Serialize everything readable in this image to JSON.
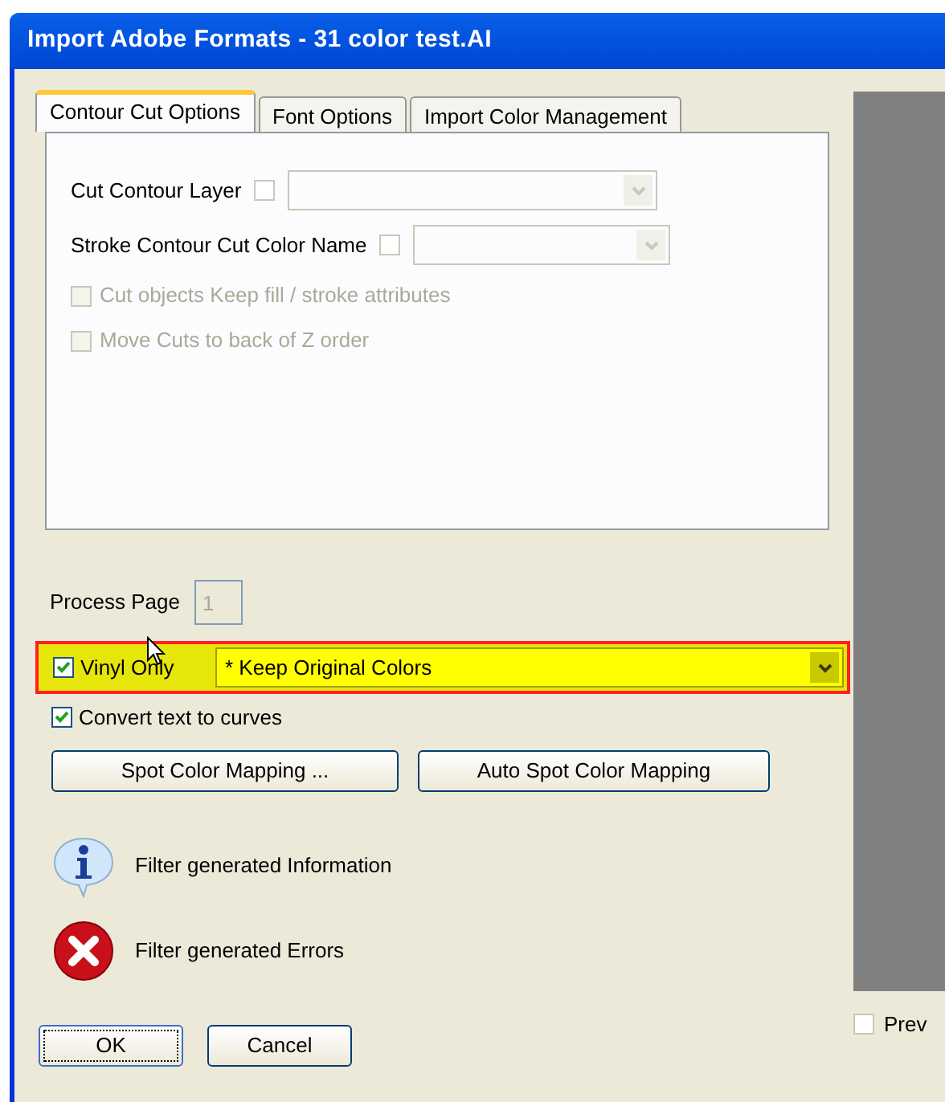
{
  "window": {
    "title": "Import Adobe Formats - 31 color test.AI"
  },
  "tabs": [
    {
      "label": "Contour Cut Options",
      "selected": true
    },
    {
      "label": "Font Options",
      "selected": false
    },
    {
      "label": "Import Color Management",
      "selected": false
    }
  ],
  "contour_options": [
    {
      "kind": "combo",
      "label": "Cut Contour Layer",
      "checked": false,
      "disabled": false
    },
    {
      "kind": "combo",
      "label": "Stroke Contour Cut Color Name",
      "checked": false,
      "disabled": false
    },
    {
      "kind": "checkbox",
      "label": "Cut objects Keep fill / stroke attributes",
      "checked": false,
      "disabled": true
    },
    {
      "kind": "checkbox",
      "label": "Move Cuts to back of Z order",
      "checked": false,
      "disabled": true
    }
  ],
  "process_page": {
    "label": "Process Page",
    "value": "1"
  },
  "vinyl_only": {
    "label": "Vinyl Only",
    "checked": true,
    "highlighted": true,
    "dropdown_value": "* Keep Original Colors"
  },
  "convert_text": {
    "label": "Convert text to curves",
    "checked": true
  },
  "buttons": [
    "Spot Color Mapping ...",
    "Auto Spot Color Mapping"
  ],
  "messages": [
    {
      "kind": "info",
      "text": "Filter generated Information"
    },
    {
      "kind": "error",
      "text": "Filter generated Errors"
    }
  ],
  "dialog_buttons": [
    {
      "label": "OK",
      "focused": true
    },
    {
      "label": "Cancel",
      "focused": false
    }
  ],
  "preview": {
    "label": "Prev",
    "checked": false
  }
}
